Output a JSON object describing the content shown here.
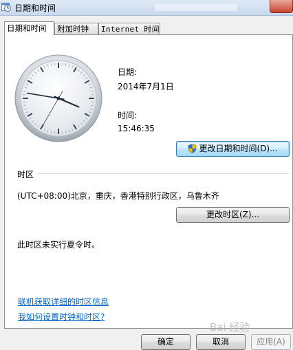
{
  "window": {
    "title": "日期和时间"
  },
  "tabs": [
    {
      "label": "日期和时间",
      "active": true
    },
    {
      "label": "附加时钟",
      "active": false
    },
    {
      "label": "Internet 时间",
      "active": false
    }
  ],
  "datetime": {
    "date_label": "日期:",
    "date_value": "2014年7月1日",
    "time_label": "时间:",
    "time_value": "15:46:35",
    "change_button": "更改日期和时间(D)..."
  },
  "timezone": {
    "section_title": "时区",
    "value": "(UTC+08:00)北京，重庆，香港特别行政区，乌鲁木齐",
    "change_button": "更改时区(Z)...",
    "dst_note": "此时区未实行夏令时。"
  },
  "links": {
    "online_info": "联机获取详细的时区信息",
    "how_to": "我如何设置时钟和时区?"
  },
  "footer": {
    "ok": "确定",
    "cancel": "取消",
    "apply": "应用(A)"
  },
  "clock": {
    "hours": 15,
    "minutes": 46,
    "seconds": 35
  },
  "icons": {
    "window": "clock-calendar-icon",
    "uac": "uac-shield-icon"
  },
  "watermark": "Bai 经验"
}
